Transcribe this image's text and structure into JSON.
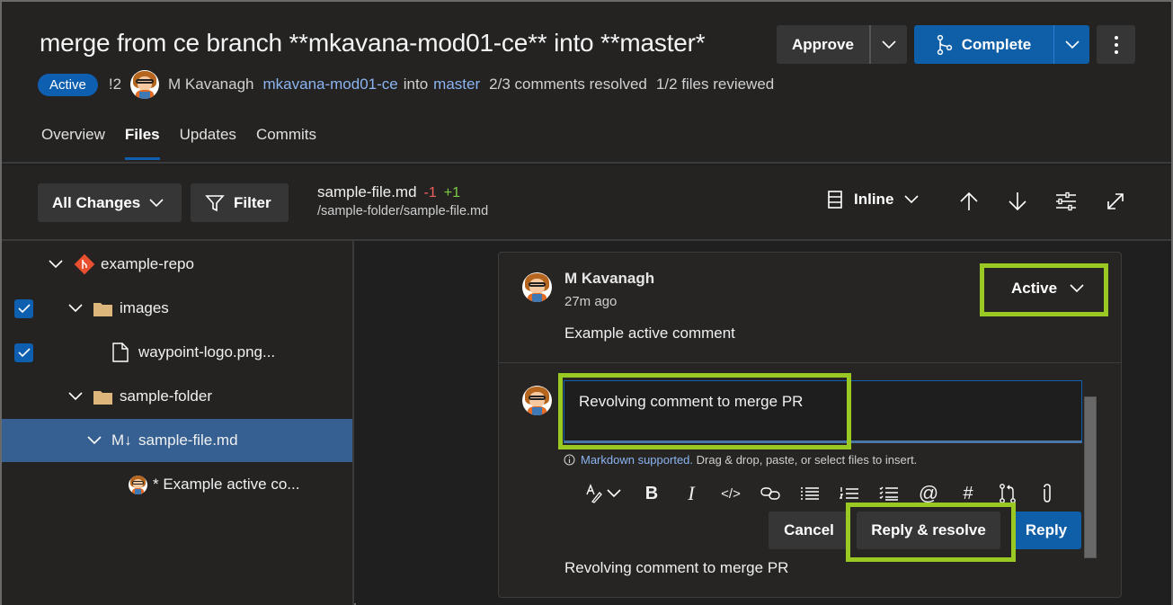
{
  "header": {
    "title": "merge from ce branch **mkavana-mod01-ce** into **master*",
    "status_badge": "Active",
    "pr_id": "!2",
    "author": "M Kavanagh",
    "source_branch": "mkavana-mod01-ce",
    "into": "into",
    "target_branch": "master",
    "comments_resolved": "2/3 comments resolved",
    "files_reviewed": "1/2 files reviewed",
    "actions": {
      "approve": "Approve",
      "complete": "Complete",
      "more_icon": "more-vertical-icon"
    }
  },
  "tabs": [
    {
      "label": "Overview",
      "active": false
    },
    {
      "label": "Files",
      "active": true
    },
    {
      "label": "Updates",
      "active": false
    },
    {
      "label": "Commits",
      "active": false
    }
  ],
  "toolbar": {
    "changes_selector": "All Changes",
    "filter": "Filter",
    "file_name": "sample-file.md",
    "deletions": "-1",
    "additions": "+1",
    "file_path": "/sample-folder/sample-file.md",
    "view_mode": "Inline",
    "icons": [
      "view-layout-icon",
      "previous-arrow-up-icon",
      "next-arrow-down-icon",
      "settings-sliders-icon",
      "expand-icon"
    ]
  },
  "file_tree": [
    {
      "label": "example-repo",
      "type": "repo",
      "checked": null
    },
    {
      "label": "images",
      "type": "folder",
      "checked": true
    },
    {
      "label": "waypoint-logo.png...",
      "type": "file",
      "checked": true
    },
    {
      "label": "sample-folder",
      "type": "folder",
      "checked": null
    },
    {
      "label": "sample-file.md",
      "type": "markdown",
      "prefix": "M↓",
      "checked": null,
      "selected": true
    },
    {
      "label": "* Example active co...",
      "type": "comment",
      "checked": null
    }
  ],
  "thread": {
    "author": "M Kavanagh",
    "time": "27m ago",
    "comment": "Example active comment",
    "status": "Active",
    "reply_text": "Revolving comment to merge PR",
    "markdown_link": "Markdown supported.",
    "markdown_hint": " Drag & drop, paste, or select files to insert.",
    "format_icons": [
      "text-style-icon",
      "bold-icon",
      "italic-icon",
      "code-icon",
      "link-icon",
      "bulleted-list-icon",
      "numbered-list-icon",
      "checklist-icon",
      "mention-icon",
      "work-item-hash-icon",
      "pull-request-icon",
      "attach-icon"
    ],
    "buttons": {
      "cancel": "Cancel",
      "reply_resolve": "Reply & resolve",
      "reply": "Reply"
    },
    "preview_text": "Revolving comment to merge PR"
  },
  "colors": {
    "accent": "#0f5fa8",
    "highlight": "#9ac924",
    "deletions": "#f0605f",
    "additions": "#7ccc44",
    "selected_row": "#366092"
  }
}
